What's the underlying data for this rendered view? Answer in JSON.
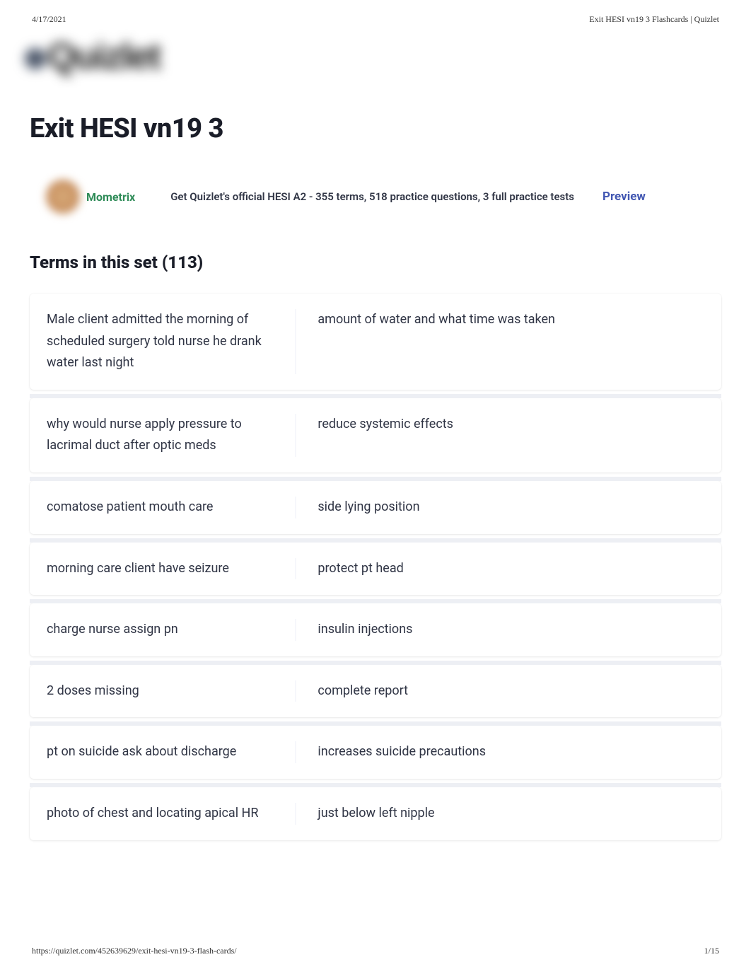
{
  "meta": {
    "date": "4/17/2021",
    "page_title": "Exit HESI vn19 3 Flashcards | Quizlet"
  },
  "logo_text": "Quizlet",
  "title": "Exit HESI vn19 3",
  "promo": {
    "brand": "Mometrix",
    "text": "Get Quizlet's official HESI A2 - 355 terms, 518 practice questions, 3 full practice tests",
    "link_text": "Preview"
  },
  "terms_header": "Terms in this set (113)",
  "cards": [
    {
      "term": "Male client admitted the morning of scheduled surgery told nurse he drank water last night",
      "def": "amount of water and what time was taken"
    },
    {
      "term": "why would nurse apply pressure to lacrimal duct after optic meds",
      "def": "reduce systemic effects"
    },
    {
      "term": "comatose patient mouth care",
      "def": "side lying position"
    },
    {
      "term": "morning care client have seizure",
      "def": "protect pt head"
    },
    {
      "term": "charge nurse assign pn",
      "def": "insulin injections"
    },
    {
      "term": "2 doses missing",
      "def": "complete report"
    },
    {
      "term": "pt on suicide ask about discharge",
      "def": "increases suicide precautions"
    },
    {
      "term": "photo of chest and locating apical HR",
      "def": "just below left nipple"
    }
  ],
  "footer": {
    "url": "https://quizlet.com/452639629/exit-hesi-vn19-3-flash-cards/",
    "page": "1/15"
  }
}
